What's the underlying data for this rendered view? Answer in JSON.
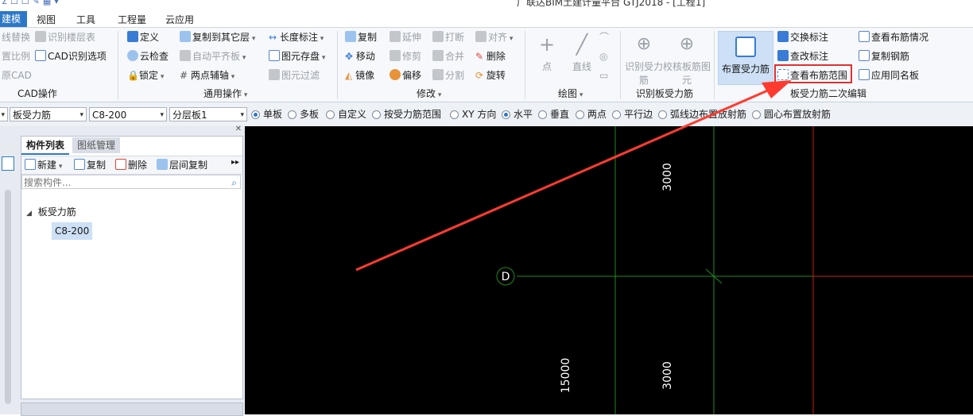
{
  "app": {
    "title": "广联达BIM土建计量平台 GTJ2018 - [工程1]"
  },
  "menu": {
    "items": [
      {
        "label": "建模",
        "active": true
      },
      {
        "label": "视图"
      },
      {
        "label": "工具"
      },
      {
        "label": "工程量"
      },
      {
        "label": "云应用"
      }
    ]
  },
  "ribbon": {
    "cad_group": {
      "label": "CAD操作",
      "items": [
        "线替换",
        "识别楼层表",
        "置比例",
        "CAD识别选项",
        "原CAD"
      ]
    },
    "common_group": {
      "label": "通用操作",
      "items": [
        "定义",
        "复制到其它层",
        "长度标注",
        "云检查",
        "自动平齐板",
        "图元存盘",
        "锁定",
        "两点辅轴",
        "图元过滤"
      ]
    },
    "modify_group": {
      "label": "修改",
      "items": [
        "复制",
        "延伸",
        "打断",
        "对齐",
        "移动",
        "修剪",
        "合并",
        "删除",
        "镜像",
        "偏移",
        "分割",
        "旋转"
      ]
    },
    "draw_group": {
      "label": "绘图",
      "items": [
        "点",
        "直线"
      ]
    },
    "identify_group": {
      "label": "识别板受力筋",
      "items": [
        "识别受力筋",
        "校核板筋图元"
      ]
    },
    "second_edit_group": {
      "label": "板受力筋二次编辑",
      "place_button": "布置受力筋",
      "items": [
        "交换标注",
        "查看布筋情况",
        "查改标注",
        "复制钢筋",
        "查看布筋范围",
        "应用同名板"
      ]
    }
  },
  "propbar": {
    "type_select": "板受力筋",
    "spec_select": "C8-200",
    "layer_select": "分层板1",
    "radios": [
      {
        "label": "单板",
        "checked": true
      },
      {
        "label": "多板",
        "checked": false
      },
      {
        "label": "自定义",
        "checked": false
      },
      {
        "label": "按受力筋范围",
        "checked": false
      },
      {
        "label": "XY 方向",
        "checked": true
      },
      {
        "label": "水平",
        "checked": false
      },
      {
        "label": "垂直",
        "checked": false
      },
      {
        "label": "两点",
        "checked": false
      },
      {
        "label": "平行边",
        "checked": false
      },
      {
        "label": "弧线边布置放射筋",
        "checked": false
      },
      {
        "label": "圆心布置放射筋",
        "checked": false
      }
    ]
  },
  "left_panel": {
    "tabs": [
      "构件列表",
      "图纸管理"
    ],
    "tools": [
      "新建",
      "复制",
      "删除",
      "层间复制"
    ],
    "search_placeholder": "搜索构件...",
    "tree_root": "板受力筋",
    "tree_child": "C8-200"
  },
  "canvas": {
    "axis_label": "D",
    "dims": [
      "3000",
      "3000",
      "15000"
    ],
    "colors": {
      "background": "#000000",
      "grid": "#1e8c1e",
      "axis_red": "#c81e1e",
      "text": "#ffffff",
      "arrow": "#ff3b30"
    }
  }
}
